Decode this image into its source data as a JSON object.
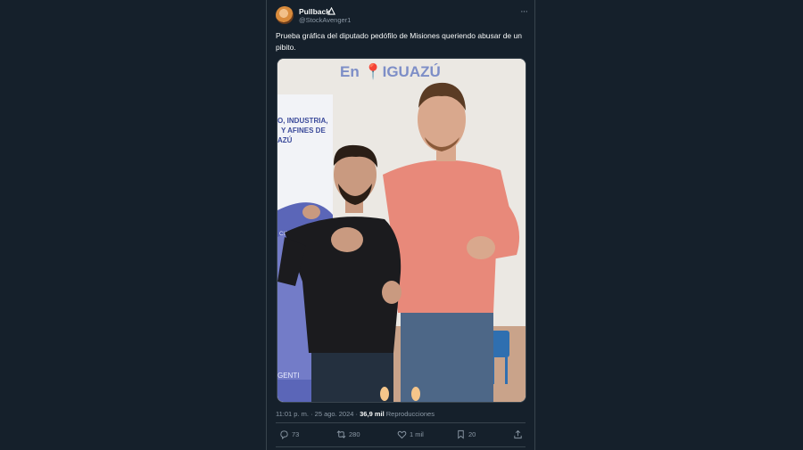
{
  "tweet": {
    "display_name": "Pullback",
    "handle": "@StockAvenger1",
    "text": "Prueba gráfica del diputado pedófilo de Misiones queriendo abusar de un pibito.",
    "photo": {
      "sign_text": "En 📍IGUAZÚ",
      "banner_lines": [
        "O, INDUSTRIA,",
        "Y AFINES DE",
        "AZÚ"
      ],
      "banner_footer": "GENTI",
      "banner_side": "CIO"
    },
    "time": "11:01 p. m.",
    "date": "25 ago. 2024",
    "separator": "·",
    "views_count": "36,9 mil",
    "views_label": "Reproducciones",
    "actions": {
      "replies": "73",
      "retweets": "280",
      "likes": "1 mil",
      "bookmarks": "20"
    }
  },
  "colors": {
    "background": "#15202b",
    "text": "#f7f9f9",
    "muted": "#8b98a5",
    "border": "#38444d"
  },
  "icons": [
    "avatar",
    "verified-icon",
    "more-icon",
    "reply-icon",
    "retweet-icon",
    "like-icon",
    "bookmark-icon",
    "share-icon"
  ]
}
